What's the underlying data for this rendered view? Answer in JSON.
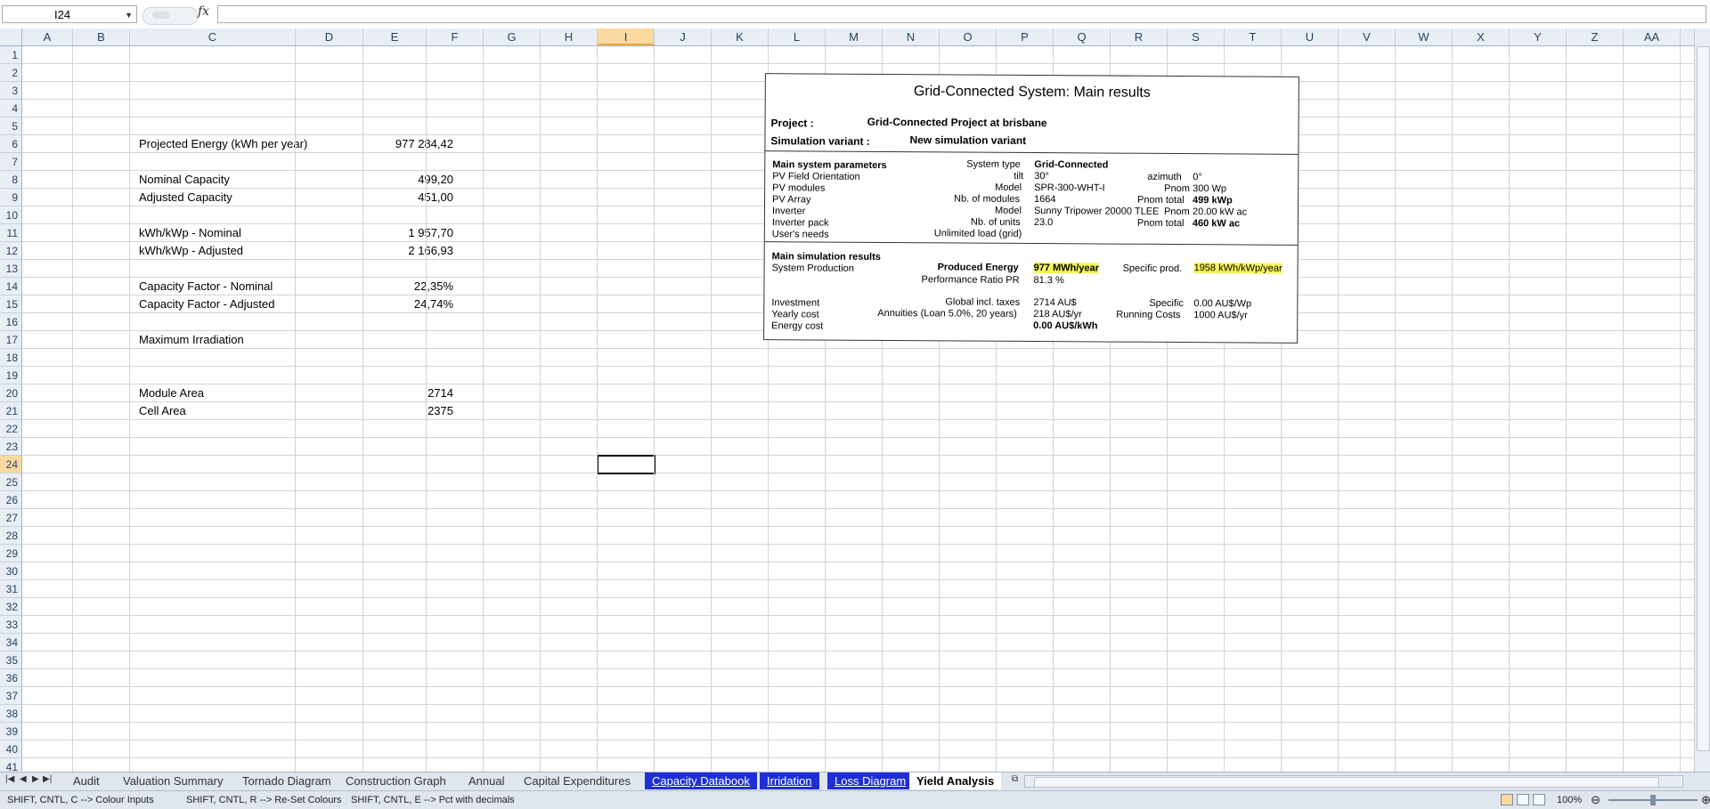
{
  "formula_bar": {
    "name_box": "I24",
    "fx": "fx",
    "formula": ""
  },
  "columns": [
    "A",
    "B",
    "C",
    "D",
    "E",
    "F",
    "G",
    "H",
    "I",
    "J",
    "K",
    "L",
    "M",
    "N",
    "O",
    "P",
    "Q",
    "R",
    "S",
    "T",
    "U",
    "V",
    "W",
    "X",
    "Y",
    "Z",
    "AA"
  ],
  "selected_column": "I",
  "selected_row": 24,
  "rows": [
    "1",
    "2",
    "3",
    "4",
    "5",
    "6",
    "7",
    "8",
    "9",
    "10",
    "11",
    "12",
    "13",
    "14",
    "15",
    "16",
    "17",
    "18",
    "19",
    "20",
    "21",
    "22",
    "23",
    "24",
    "25",
    "26",
    "27",
    "28",
    "29",
    "30",
    "31",
    "32",
    "33",
    "34",
    "35",
    "36",
    "37",
    "38",
    "39",
    "40",
    "41"
  ],
  "sheet": {
    "r6": {
      "label": "Projected Energy (kWh per year)",
      "value": "977 284,42"
    },
    "r8": {
      "label": "Nominal Capacity",
      "value": "499,20"
    },
    "r9": {
      "label": "Adjusted Capacity",
      "value": "451,00"
    },
    "r11": {
      "label": "kWh/kWp - Nominal",
      "value": "1 957,70"
    },
    "r12": {
      "label": "kWh/kWp - Adjusted",
      "value": "2 166,93"
    },
    "r14": {
      "label": "Capacity Factor - Nominal",
      "value": "22,35%"
    },
    "r15": {
      "label": "Capacity Factor - Adjusted",
      "value": "24,74%"
    },
    "r17": {
      "label": "Maximum Irradiation",
      "value": ""
    },
    "r20": {
      "label": "Module Area",
      "value": "2714"
    },
    "r21": {
      "label": "Cell Area",
      "value": "2375"
    }
  },
  "report": {
    "title": "Grid-Connected System: Main results",
    "project_label": "Project  :",
    "project_value": "Grid-Connected Project at brisbane",
    "variant_label": "Simulation variant  :",
    "variant_value": "New simulation variant",
    "params_heading": "Main system parameters",
    "system_type_label": "System type",
    "system_type_value": "Grid-Connected",
    "orientation": "PV Field Orientation",
    "tilt_label": "tilt",
    "tilt_value": "30°",
    "azimuth_label": "azimuth",
    "azimuth_value": "0°",
    "pv_modules": "PV modules",
    "model_label": "Model",
    "model_value": "SPR-300-WHT-I",
    "pnom_label": "Pnom",
    "pnom_value": "300 Wp",
    "pv_array": "PV Array",
    "nb_modules_label": "Nb. of modules",
    "nb_modules_value": "1664",
    "pnom_total_label": "Pnom total",
    "pnom_total_value": "499 kWp",
    "inverter": "Inverter",
    "inv_model_label": "Model",
    "inv_model_value": "Sunny Tripower 20000 TLEE",
    "inv_pnom_label": "Pnom",
    "inv_pnom_value": "20.00 kW ac",
    "inverter_pack": "Inverter pack",
    "nb_units_label": "Nb. of units",
    "nb_units_value": "23.0",
    "inv_pnom_total_label": "Pnom total",
    "inv_pnom_total_value": "460 kW ac",
    "users_needs": "User's needs",
    "users_needs_value": "Unlimited load (grid)",
    "results_heading": "Main simulation results",
    "system_production": "System Production",
    "produced_energy_label": "Produced Energy",
    "produced_energy_value": "977 MWh/year",
    "specific_prod_label": "Specific prod.",
    "specific_prod_value": "1958 kWh/kWp/year",
    "pr_label": "Performance Ratio PR",
    "pr_value": "81.3 %",
    "investment": "Investment",
    "global_taxes_label": "Global incl. taxes",
    "global_taxes_value": "2714 AU$",
    "specific_label": "Specific",
    "specific_value": "0.00 AU$/Wp",
    "yearly_cost": "Yearly cost",
    "annuities_label": "Annuities (Loan 5.0%, 20 years)",
    "annuities_value": "218 AU$/yr",
    "running_costs_label": "Running Costs",
    "running_costs_value": "1000 AU$/yr",
    "energy_cost": "Energy cost",
    "energy_cost_value": "0.00 AU$/kWh"
  },
  "tabs": [
    {
      "label": "Audit",
      "style": "normal"
    },
    {
      "label": "Valuation Summary",
      "style": "normal"
    },
    {
      "label": "Tornado Diagram",
      "style": "normal"
    },
    {
      "label": "Construction Graph",
      "style": "normal"
    },
    {
      "label": "Annual",
      "style": "normal"
    },
    {
      "label": "Capital Expenditures",
      "style": "normal"
    },
    {
      "label": "Capacity Databook",
      "style": "blue"
    },
    {
      "label": "Irridation",
      "style": "blue"
    },
    {
      "label": "Loss Diagram",
      "style": "blue"
    },
    {
      "label": "Yield Analysis",
      "style": "active"
    }
  ],
  "status": {
    "m1": "SHIFT, CNTL, C --> Colour Inputs",
    "m2": "SHIFT, CNTL, R --> Re-Set Colours",
    "m3": "SHIFT, CNTL, E --> Pct with decimals",
    "zoom": "100%"
  },
  "colors": {
    "selected_header": "#f9d99f",
    "tab_blue": "#1e2fd6",
    "highlight": "#f4f45a"
  }
}
